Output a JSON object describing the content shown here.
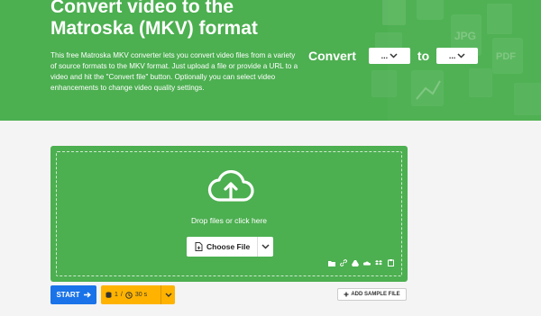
{
  "hero": {
    "title": "Convert video to the Matroska (MKV) format",
    "description": "This free Matroska MKV converter lets you convert video files from a variety of source formats to the MKV format. Just upload a file or provide a URL to a video and hit the \"Convert file\" button. Optionally you can select video enhancements to change video quality settings.",
    "convert_label": "Convert",
    "to_label": "to",
    "from_select": "...",
    "to_select": "...",
    "bg_labels": {
      "jpg": "JPG",
      "pdf": "PDF"
    }
  },
  "dropzone": {
    "text": "Drop files or click here",
    "choose_label": "Choose File"
  },
  "actions": {
    "start_label": "START",
    "files_count": "1",
    "separator": "/",
    "time_limit": "30 s",
    "sample_label": "ADD SAMPLE FILE"
  },
  "colors": {
    "green": "#4caf50",
    "blue": "#1a73e8",
    "amber": "#ffb300"
  }
}
